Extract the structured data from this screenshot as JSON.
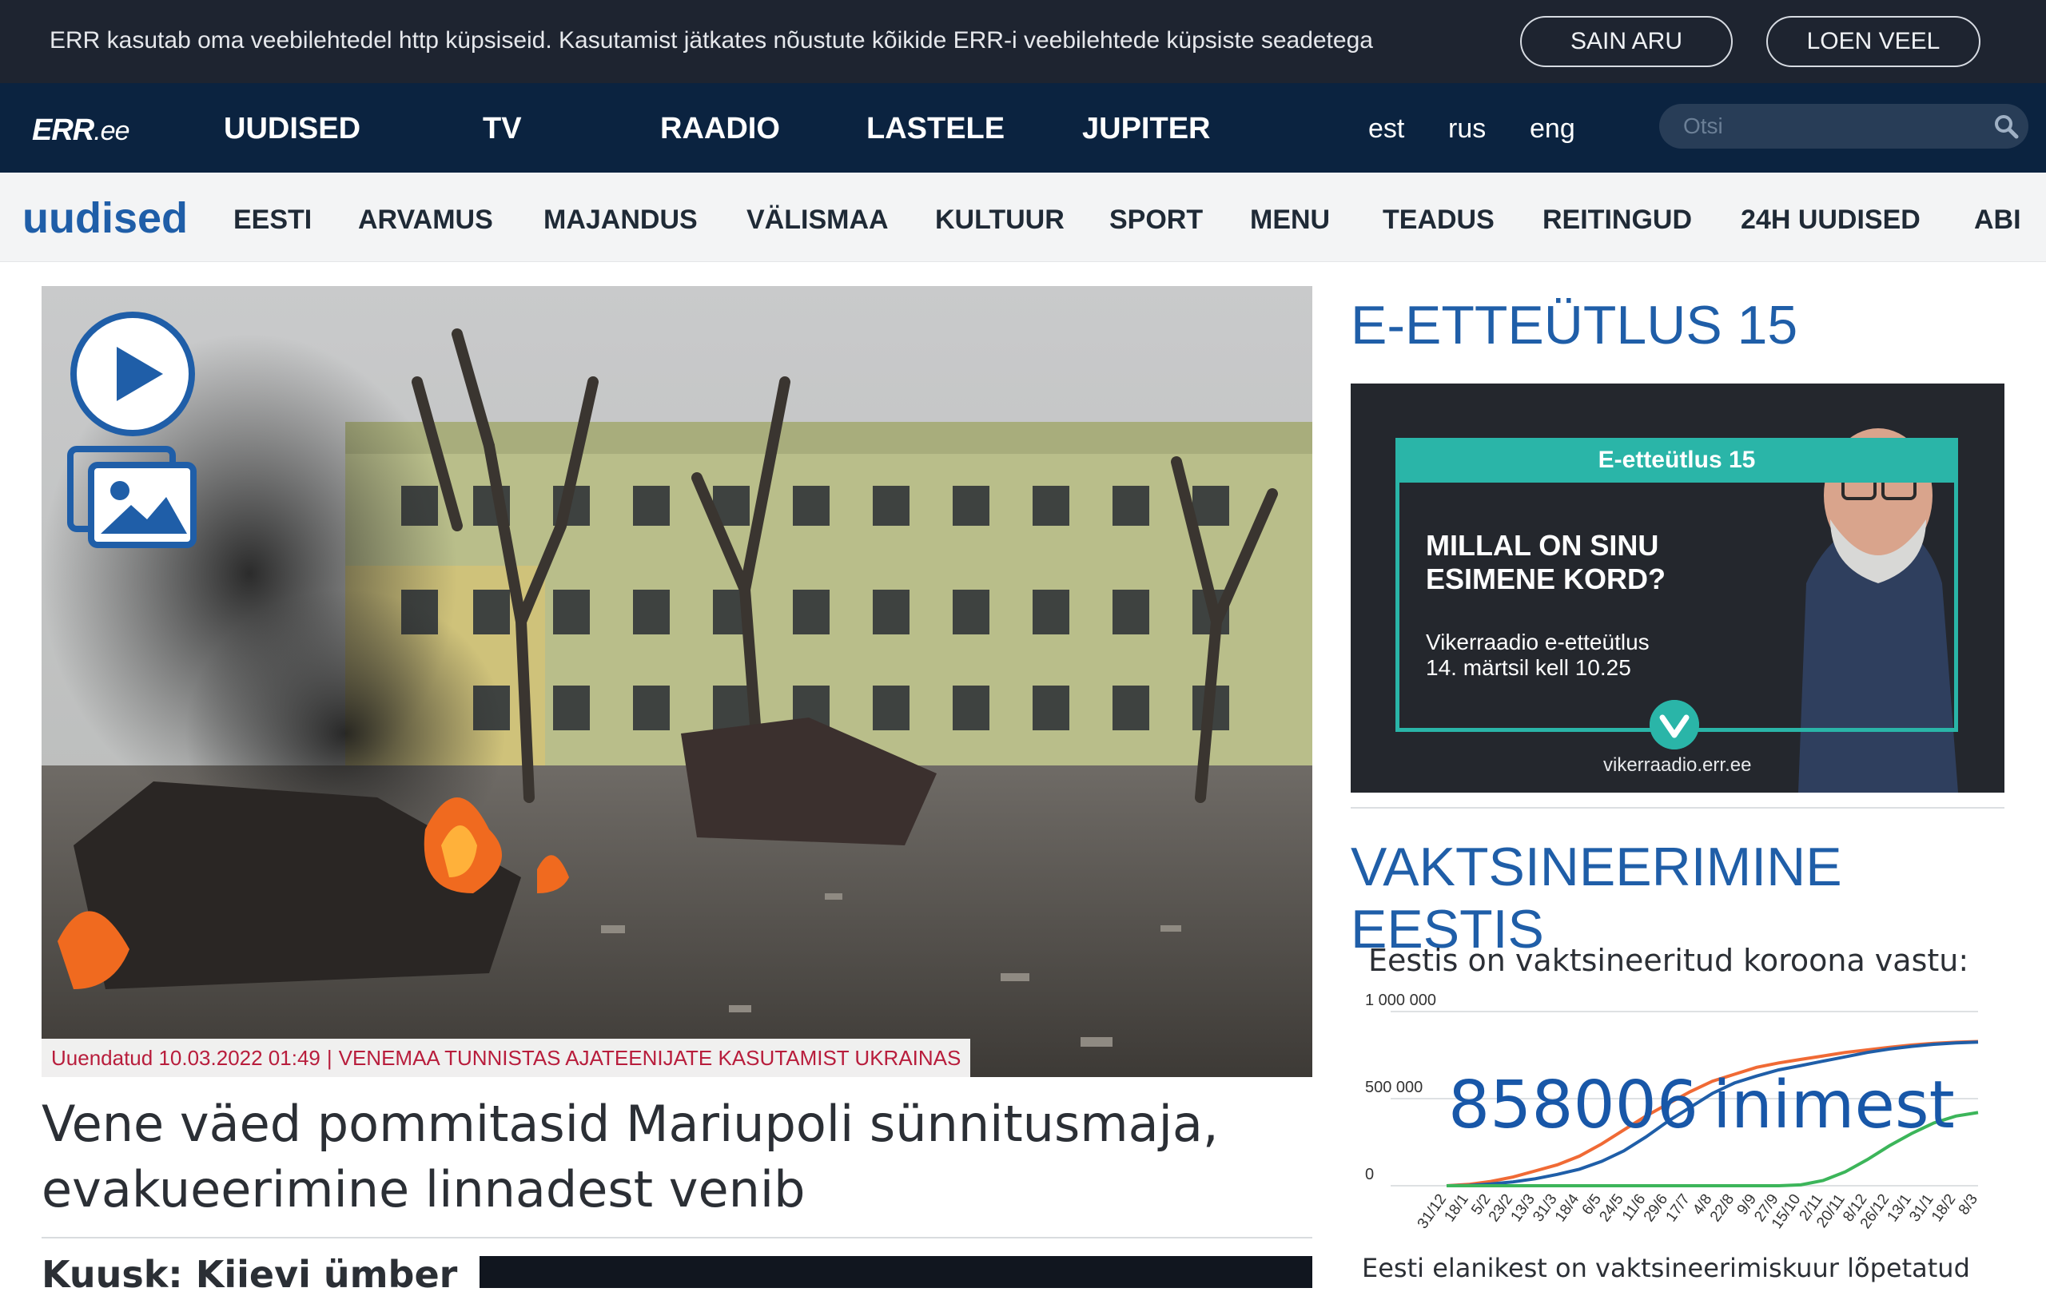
{
  "cookie_bar": {
    "message": "ERR kasutab oma veebilehtedel http küpsiseid. Kasutamist jätkates nõustute kõikide ERR-i veebilehtede küpsiste seadetega",
    "accept_label": "SAIN ARU",
    "more_label": "LOEN VEEL"
  },
  "header": {
    "logo_main": "ERR",
    "logo_suffix": ".ee",
    "nav": [
      "UUDISED",
      "TV",
      "RAADIO",
      "LASTELE",
      "JUPITER"
    ],
    "languages": [
      "est",
      "rus",
      "eng"
    ],
    "search_placeholder": "Otsi",
    "search_icon": "search-icon"
  },
  "subnav": {
    "section": "uudised",
    "items": [
      "EESTI",
      "ARVAMUS",
      "MAJANDUS",
      "VÄLISMAA",
      "KULTUUR",
      "SPORT",
      "MENU",
      "TEADUS",
      "REITINGUD",
      "24H UUDISED",
      "ABI"
    ]
  },
  "hero": {
    "updated": "Uuendatud 10.03.2022 01:49",
    "separator": "|",
    "topic": "VENEMAA TUNNISTAS AJATEENIJATE KASUTAMIST UKRAINAS",
    "title": "Vene väed pommitasid Mariupoli sünnitusmaja, evakueerimine linnadest venib",
    "icons": [
      "play-icon",
      "gallery-icon"
    ]
  },
  "secondary": {
    "headline": "Kuusk: Kiievi ümber"
  },
  "right": {
    "promo_title": "E-ETTEÜTLUS 15",
    "banner": {
      "tab": "E-etteütlus 15",
      "question_line1": "MILLAL ON SINU",
      "question_line2": "ESIMENE KORD?",
      "info_line1": "Vikerraadio e-etteütlus",
      "info_line2": "14. märtsil kell 10.25",
      "site": "vikerraadio.err.ee"
    },
    "vax_title": "VAKTSINEERIMINE EESTIS",
    "vax_heading": "Eestis on vaktsineeritud koroona vastu:",
    "vax_count": "858006",
    "vax_unit": "inimest",
    "vax_footer": "Eesti elanikest on vaktsineerimiskuur lõpetatud"
  },
  "chart_data": {
    "type": "line",
    "title": "",
    "xlabel": "",
    "ylabel": "",
    "ylim": [
      0,
      1000000
    ],
    "y_ticks": [
      "1 000 000",
      "500 000",
      "0"
    ],
    "x": [
      "31/12",
      "18/1",
      "5/2",
      "23/2",
      "13/3",
      "31/3",
      "18/4",
      "6/5",
      "24/5",
      "11/6",
      "29/6",
      "17/7",
      "4/8",
      "22/8",
      "9/9",
      "27/9",
      "15/10",
      "2/11",
      "20/11",
      "8/12",
      "26/12",
      "13/1",
      "31/1",
      "18/2",
      "8/3"
    ],
    "series": [
      {
        "color": "#f06a35",
        "values": [
          0,
          8000,
          25000,
          50000,
          85000,
          120000,
          170000,
          240000,
          320000,
          400000,
          470000,
          540000,
          600000,
          640000,
          680000,
          705000,
          725000,
          745000,
          765000,
          780000,
          795000,
          808000,
          818000,
          824000,
          828000
        ]
      },
      {
        "color": "#1f5ea8",
        "values": [
          0,
          2000,
          10000,
          22000,
          40000,
          65000,
          95000,
          140000,
          200000,
          280000,
          370000,
          450000,
          530000,
          590000,
          630000,
          665000,
          690000,
          715000,
          740000,
          765000,
          785000,
          800000,
          812000,
          820000,
          825000
        ]
      },
      {
        "color": "#3cb55a",
        "values": [
          0,
          0,
          0,
          0,
          0,
          0,
          0,
          0,
          0,
          0,
          0,
          0,
          0,
          0,
          0,
          0,
          5000,
          30000,
          80000,
          150000,
          230000,
          300000,
          360000,
          400000,
          420000
        ]
      }
    ]
  }
}
